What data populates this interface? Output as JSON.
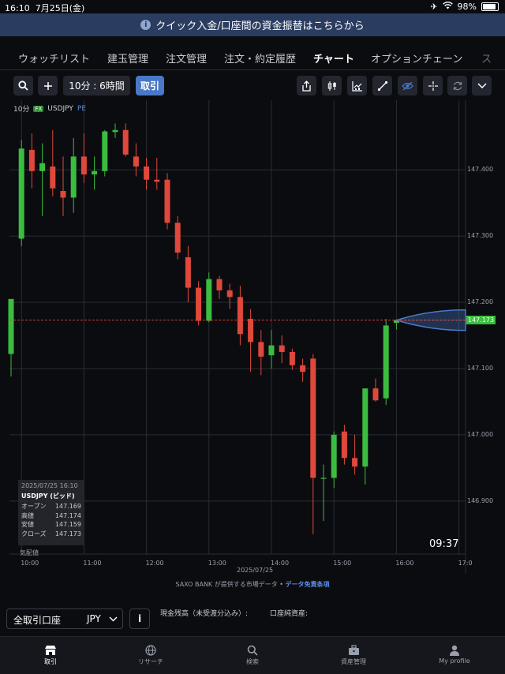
{
  "status_bar": {
    "time": "16:10",
    "date": "7月25日(金)",
    "battery": "98%"
  },
  "banner": {
    "text": "クイック入金/口座間の資金振替はこちらから"
  },
  "tabs": [
    "ウォッチリスト",
    "建玉管理",
    "注文管理",
    "注文・約定履歴",
    "チャート",
    "オプションチェーン",
    "ス"
  ],
  "active_tab": "チャート",
  "toolbar": {
    "timeframe": "10分 : 6時間",
    "trade": "取引"
  },
  "chart_header": {
    "interval": "10分",
    "badge": "FX",
    "symbol": "USDJPY",
    "pe": "PE"
  },
  "y_ticks": [
    "147.400",
    "147.300",
    "147.200",
    "147.100",
    "147.000",
    "146.900"
  ],
  "x_ticks": [
    "10:00",
    "11:00",
    "12:00",
    "13:00",
    "14:00",
    "15:00",
    "16:00",
    "17:0"
  ],
  "x_date": "2025/07/25",
  "current_price": "147.173",
  "clock": "09:37",
  "ohlc": {
    "timestamp": "2025/07/25 16:10",
    "title": "USDJPY (ビッド)",
    "rows": [
      {
        "label": "オープン",
        "value": "147.169"
      },
      {
        "label": "高値",
        "value": "147.174"
      },
      {
        "label": "安値",
        "value": "147.159"
      },
      {
        "label": "クローズ",
        "value": "147.173"
      }
    ],
    "note": "気配値"
  },
  "source": {
    "text": "SAXO BANK が提供する市場データ • ",
    "link": "データ免責条項"
  },
  "account": {
    "name": "全取引口座",
    "currency": "JPY",
    "cash_label": "現金残高（未受渡分込み）:",
    "net_label": "口座純資産:"
  },
  "nav": [
    {
      "label": "取引",
      "icon": "trade-icon"
    },
    {
      "label": "リサーチ",
      "icon": "globe-icon"
    },
    {
      "label": "検索",
      "icon": "search-icon"
    },
    {
      "label": "資産管理",
      "icon": "briefcase-icon"
    },
    {
      "label": "My profile",
      "icon": "person-icon"
    }
  ],
  "colors": {
    "up": "#3bbd3f",
    "down": "#e0483c",
    "accent": "#4a78c9",
    "banner": "#2a3c5f"
  },
  "chart_data": {
    "type": "candlestick",
    "symbol": "USDJPY",
    "interval": "10分",
    "ylim": [
      146.82,
      147.505
    ],
    "candles": [
      {
        "t": "09:50",
        "o": 147.122,
        "h": 147.205,
        "l": 147.088,
        "c": 147.205
      },
      {
        "t": "10:00",
        "o": 147.296,
        "h": 147.445,
        "l": 147.285,
        "c": 147.432
      },
      {
        "t": "10:10",
        "o": 147.43,
        "h": 147.455,
        "l": 147.372,
        "c": 147.398
      },
      {
        "t": "10:20",
        "o": 147.398,
        "h": 147.44,
        "l": 147.33,
        "c": 147.41
      },
      {
        "t": "10:30",
        "o": 147.405,
        "h": 147.46,
        "l": 147.36,
        "c": 147.372
      },
      {
        "t": "10:40",
        "o": 147.368,
        "h": 147.42,
        "l": 147.33,
        "c": 147.358
      },
      {
        "t": "10:50",
        "o": 147.358,
        "h": 147.448,
        "l": 147.335,
        "c": 147.42
      },
      {
        "t": "11:00",
        "o": 147.42,
        "h": 147.455,
        "l": 147.38,
        "c": 147.393
      },
      {
        "t": "11:10",
        "o": 147.393,
        "h": 147.42,
        "l": 147.37,
        "c": 147.398
      },
      {
        "t": "11:20",
        "o": 147.398,
        "h": 147.46,
        "l": 147.39,
        "c": 147.458
      },
      {
        "t": "11:30",
        "o": 147.457,
        "h": 147.47,
        "l": 147.448,
        "c": 147.46
      },
      {
        "t": "11:40",
        "o": 147.46,
        "h": 147.47,
        "l": 147.42,
        "c": 147.423
      },
      {
        "t": "11:50",
        "o": 147.42,
        "h": 147.44,
        "l": 147.39,
        "c": 147.405
      },
      {
        "t": "12:00",
        "o": 147.405,
        "h": 147.418,
        "l": 147.37,
        "c": 147.385
      },
      {
        "t": "12:10",
        "o": 147.385,
        "h": 147.418,
        "l": 147.37,
        "c": 147.382
      },
      {
        "t": "12:20",
        "o": 147.385,
        "h": 147.395,
        "l": 147.31,
        "c": 147.32
      },
      {
        "t": "12:30",
        "o": 147.32,
        "h": 147.33,
        "l": 147.265,
        "c": 147.275
      },
      {
        "t": "12:40",
        "o": 147.268,
        "h": 147.285,
        "l": 147.2,
        "c": 147.222
      },
      {
        "t": "12:50",
        "o": 147.222,
        "h": 147.232,
        "l": 147.165,
        "c": 147.172
      },
      {
        "t": "13:00",
        "o": 147.172,
        "h": 147.245,
        "l": 147.17,
        "c": 147.235
      },
      {
        "t": "13:10",
        "o": 147.235,
        "h": 147.24,
        "l": 147.205,
        "c": 147.218
      },
      {
        "t": "13:20",
        "o": 147.218,
        "h": 147.228,
        "l": 147.19,
        "c": 147.208
      },
      {
        "t": "13:30",
        "o": 147.208,
        "h": 147.225,
        "l": 147.135,
        "c": 147.152
      },
      {
        "t": "13:40",
        "o": 147.175,
        "h": 147.19,
        "l": 147.095,
        "c": 147.14
      },
      {
        "t": "13:50",
        "o": 147.14,
        "h": 147.158,
        "l": 147.09,
        "c": 147.118
      },
      {
        "t": "14:00",
        "o": 147.12,
        "h": 147.158,
        "l": 147.1,
        "c": 147.135
      },
      {
        "t": "14:10",
        "o": 147.135,
        "h": 147.15,
        "l": 147.108,
        "c": 147.125
      },
      {
        "t": "14:20",
        "o": 147.125,
        "h": 147.13,
        "l": 147.098,
        "c": 147.105
      },
      {
        "t": "14:30",
        "o": 147.105,
        "h": 147.115,
        "l": 147.08,
        "c": 147.095
      },
      {
        "t": "14:40",
        "o": 147.115,
        "h": 147.122,
        "l": 146.85,
        "c": 146.935
      },
      {
        "t": "14:50",
        "o": 146.935,
        "h": 146.955,
        "l": 146.87,
        "c": 146.935
      },
      {
        "t": "15:00",
        "o": 146.935,
        "h": 147.005,
        "l": 146.92,
        "c": 147.0
      },
      {
        "t": "15:10",
        "o": 147.005,
        "h": 147.015,
        "l": 146.955,
        "c": 146.965
      },
      {
        "t": "15:20",
        "o": 146.965,
        "h": 147.0,
        "l": 146.94,
        "c": 146.952
      },
      {
        "t": "15:30",
        "o": 146.952,
        "h": 147.068,
        "l": 146.925,
        "c": 147.07
      },
      {
        "t": "15:40",
        "o": 147.07,
        "h": 147.085,
        "l": 147.05,
        "c": 147.052
      },
      {
        "t": "15:50",
        "o": 147.055,
        "h": 147.175,
        "l": 147.045,
        "c": 147.165
      },
      {
        "t": "16:00",
        "o": 147.169,
        "h": 147.174,
        "l": 147.159,
        "c": 147.173
      }
    ]
  }
}
